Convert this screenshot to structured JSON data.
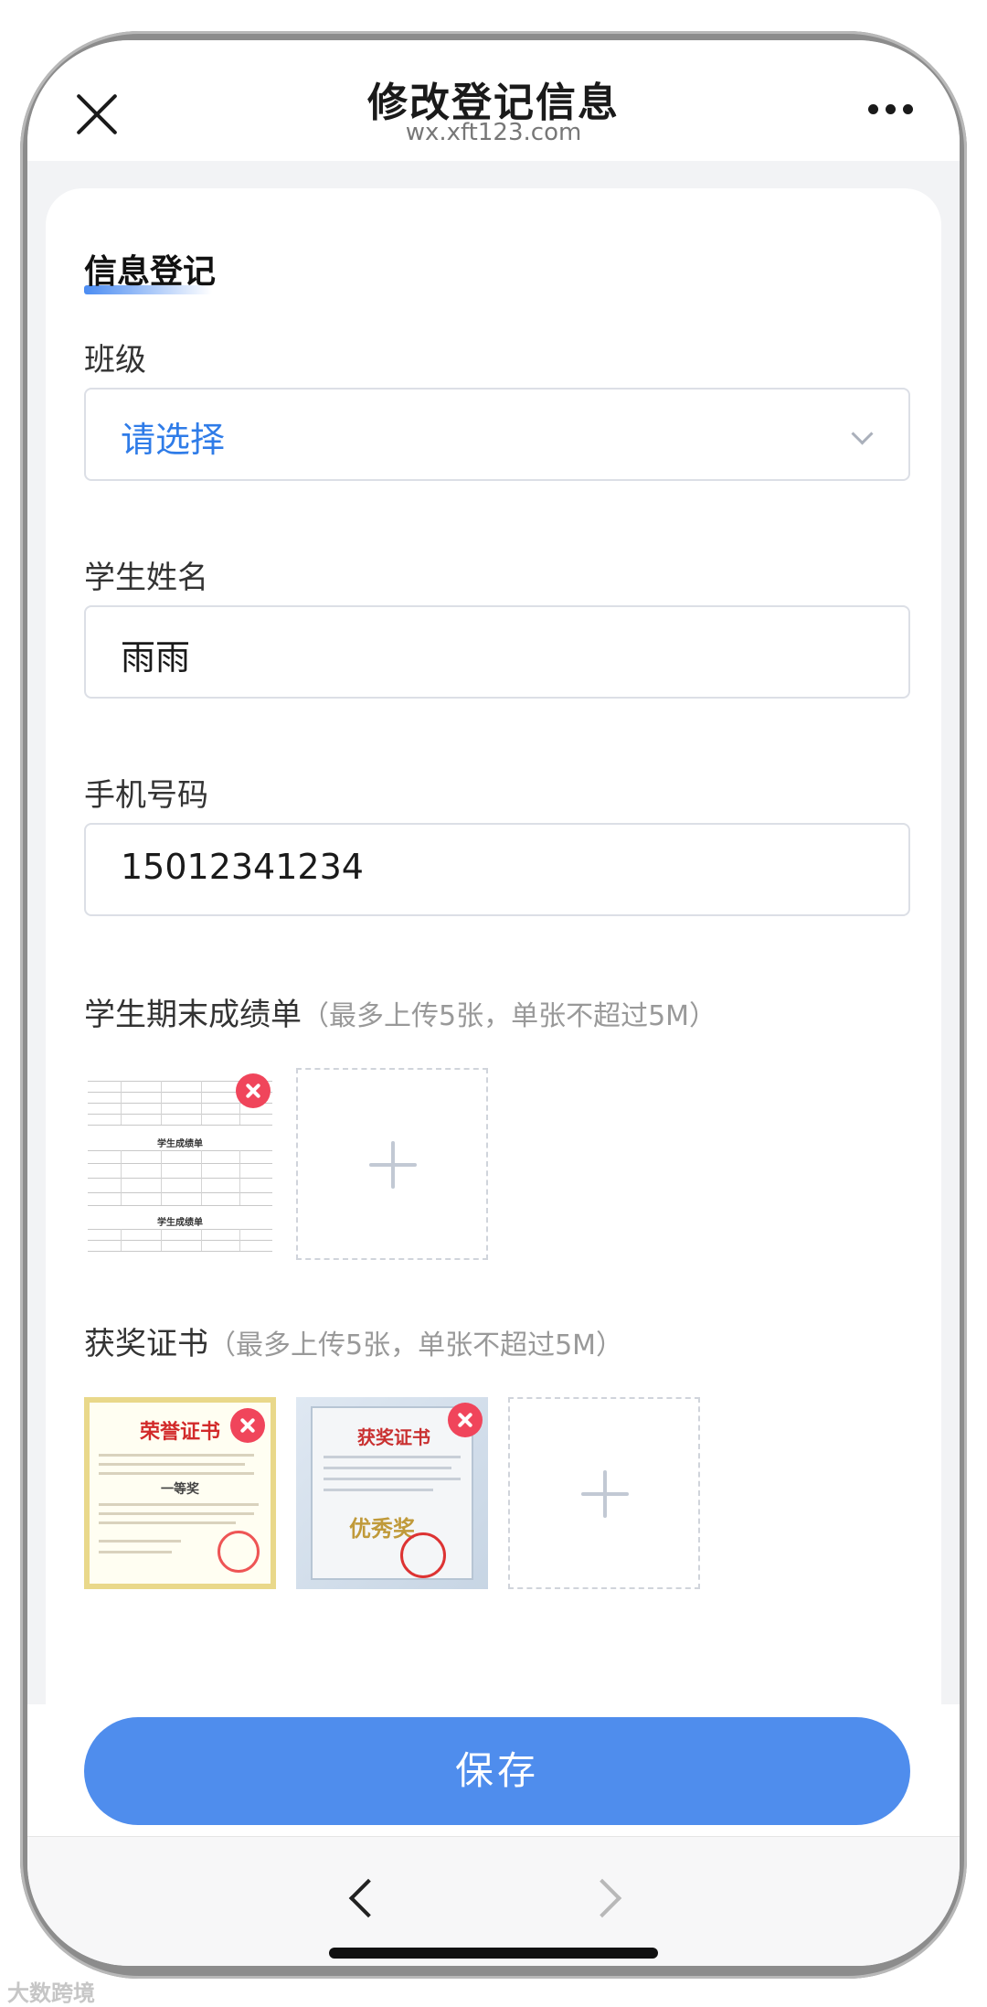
{
  "header": {
    "title": "修改登记信息",
    "domain": "wx.xft123.com"
  },
  "form": {
    "section_title": "信息登记",
    "class": {
      "label": "班级",
      "placeholder": "请选择"
    },
    "student_name": {
      "label": "学生姓名",
      "value": "雨雨"
    },
    "phone": {
      "label": "手机号码",
      "value": "15012341234"
    },
    "transcript": {
      "label": "学生期末成绩单",
      "hint": "（最多上传5张，单张不超过5M）",
      "sheet_heading": "学生成绩单",
      "uploaded_count": 1
    },
    "certificates": {
      "label": "获奖证书",
      "hint": "（最多上传5张，单张不超过5M）",
      "uploaded_count": 2,
      "items": [
        {
          "title": "荣誉证书",
          "award": "一等奖"
        },
        {
          "title": "获奖证书",
          "award": "优秀奖"
        }
      ]
    }
  },
  "save_label": "保存",
  "watermark": "大数跨境",
  "icons": {
    "close": "close-icon",
    "more": "more-icon",
    "dropdown": "chevron-down-icon",
    "remove": "remove-icon",
    "add": "plus-icon",
    "back": "chevron-left-icon",
    "forward": "chevron-right-icon"
  },
  "colors": {
    "accent": "#4f8ded",
    "placeholder": "#2f7ce8",
    "remove": "#f0455b"
  }
}
